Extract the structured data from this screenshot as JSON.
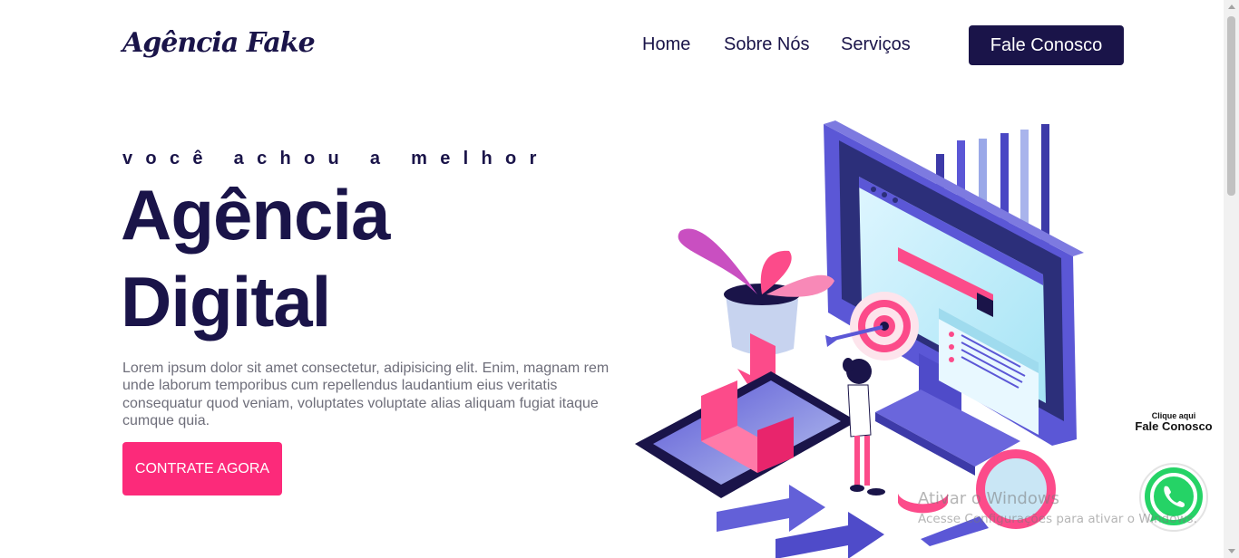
{
  "header": {
    "logo": "Agência Fake",
    "nav": [
      {
        "label": "Home"
      },
      {
        "label": "Sobre Nós"
      },
      {
        "label": "Serviços"
      }
    ],
    "cta_label": "Fale Conosco"
  },
  "hero": {
    "eyebrow": "você achou a melhor",
    "title_line1": "Agência",
    "title_line2": "Digital",
    "lead": "Lorem ipsum dolor sit amet consectetur, adipisicing elit. Enim, magnam rem unde laborum temporibus cum repellendus laudantium eius veritatis consequatur quod veniam, voluptates voluptate alias aliquam fugiat itaque cumque quia.",
    "cta_label": "CONTRATE AGORA"
  },
  "whatsapp": {
    "small": "Clique aqui",
    "big": "Fale Conosco",
    "icon": "whatsapp-icon"
  },
  "watermark": {
    "line1": "Ativar o Windows",
    "line2": "Acesse Configurações para ativar o Windows."
  },
  "colors": {
    "primary": "#1a1449",
    "accent": "#fc2a7a",
    "text_muted": "#6e6e7a",
    "illustration_blue": "#5b57d6",
    "whatsapp_green": "#25d366"
  }
}
